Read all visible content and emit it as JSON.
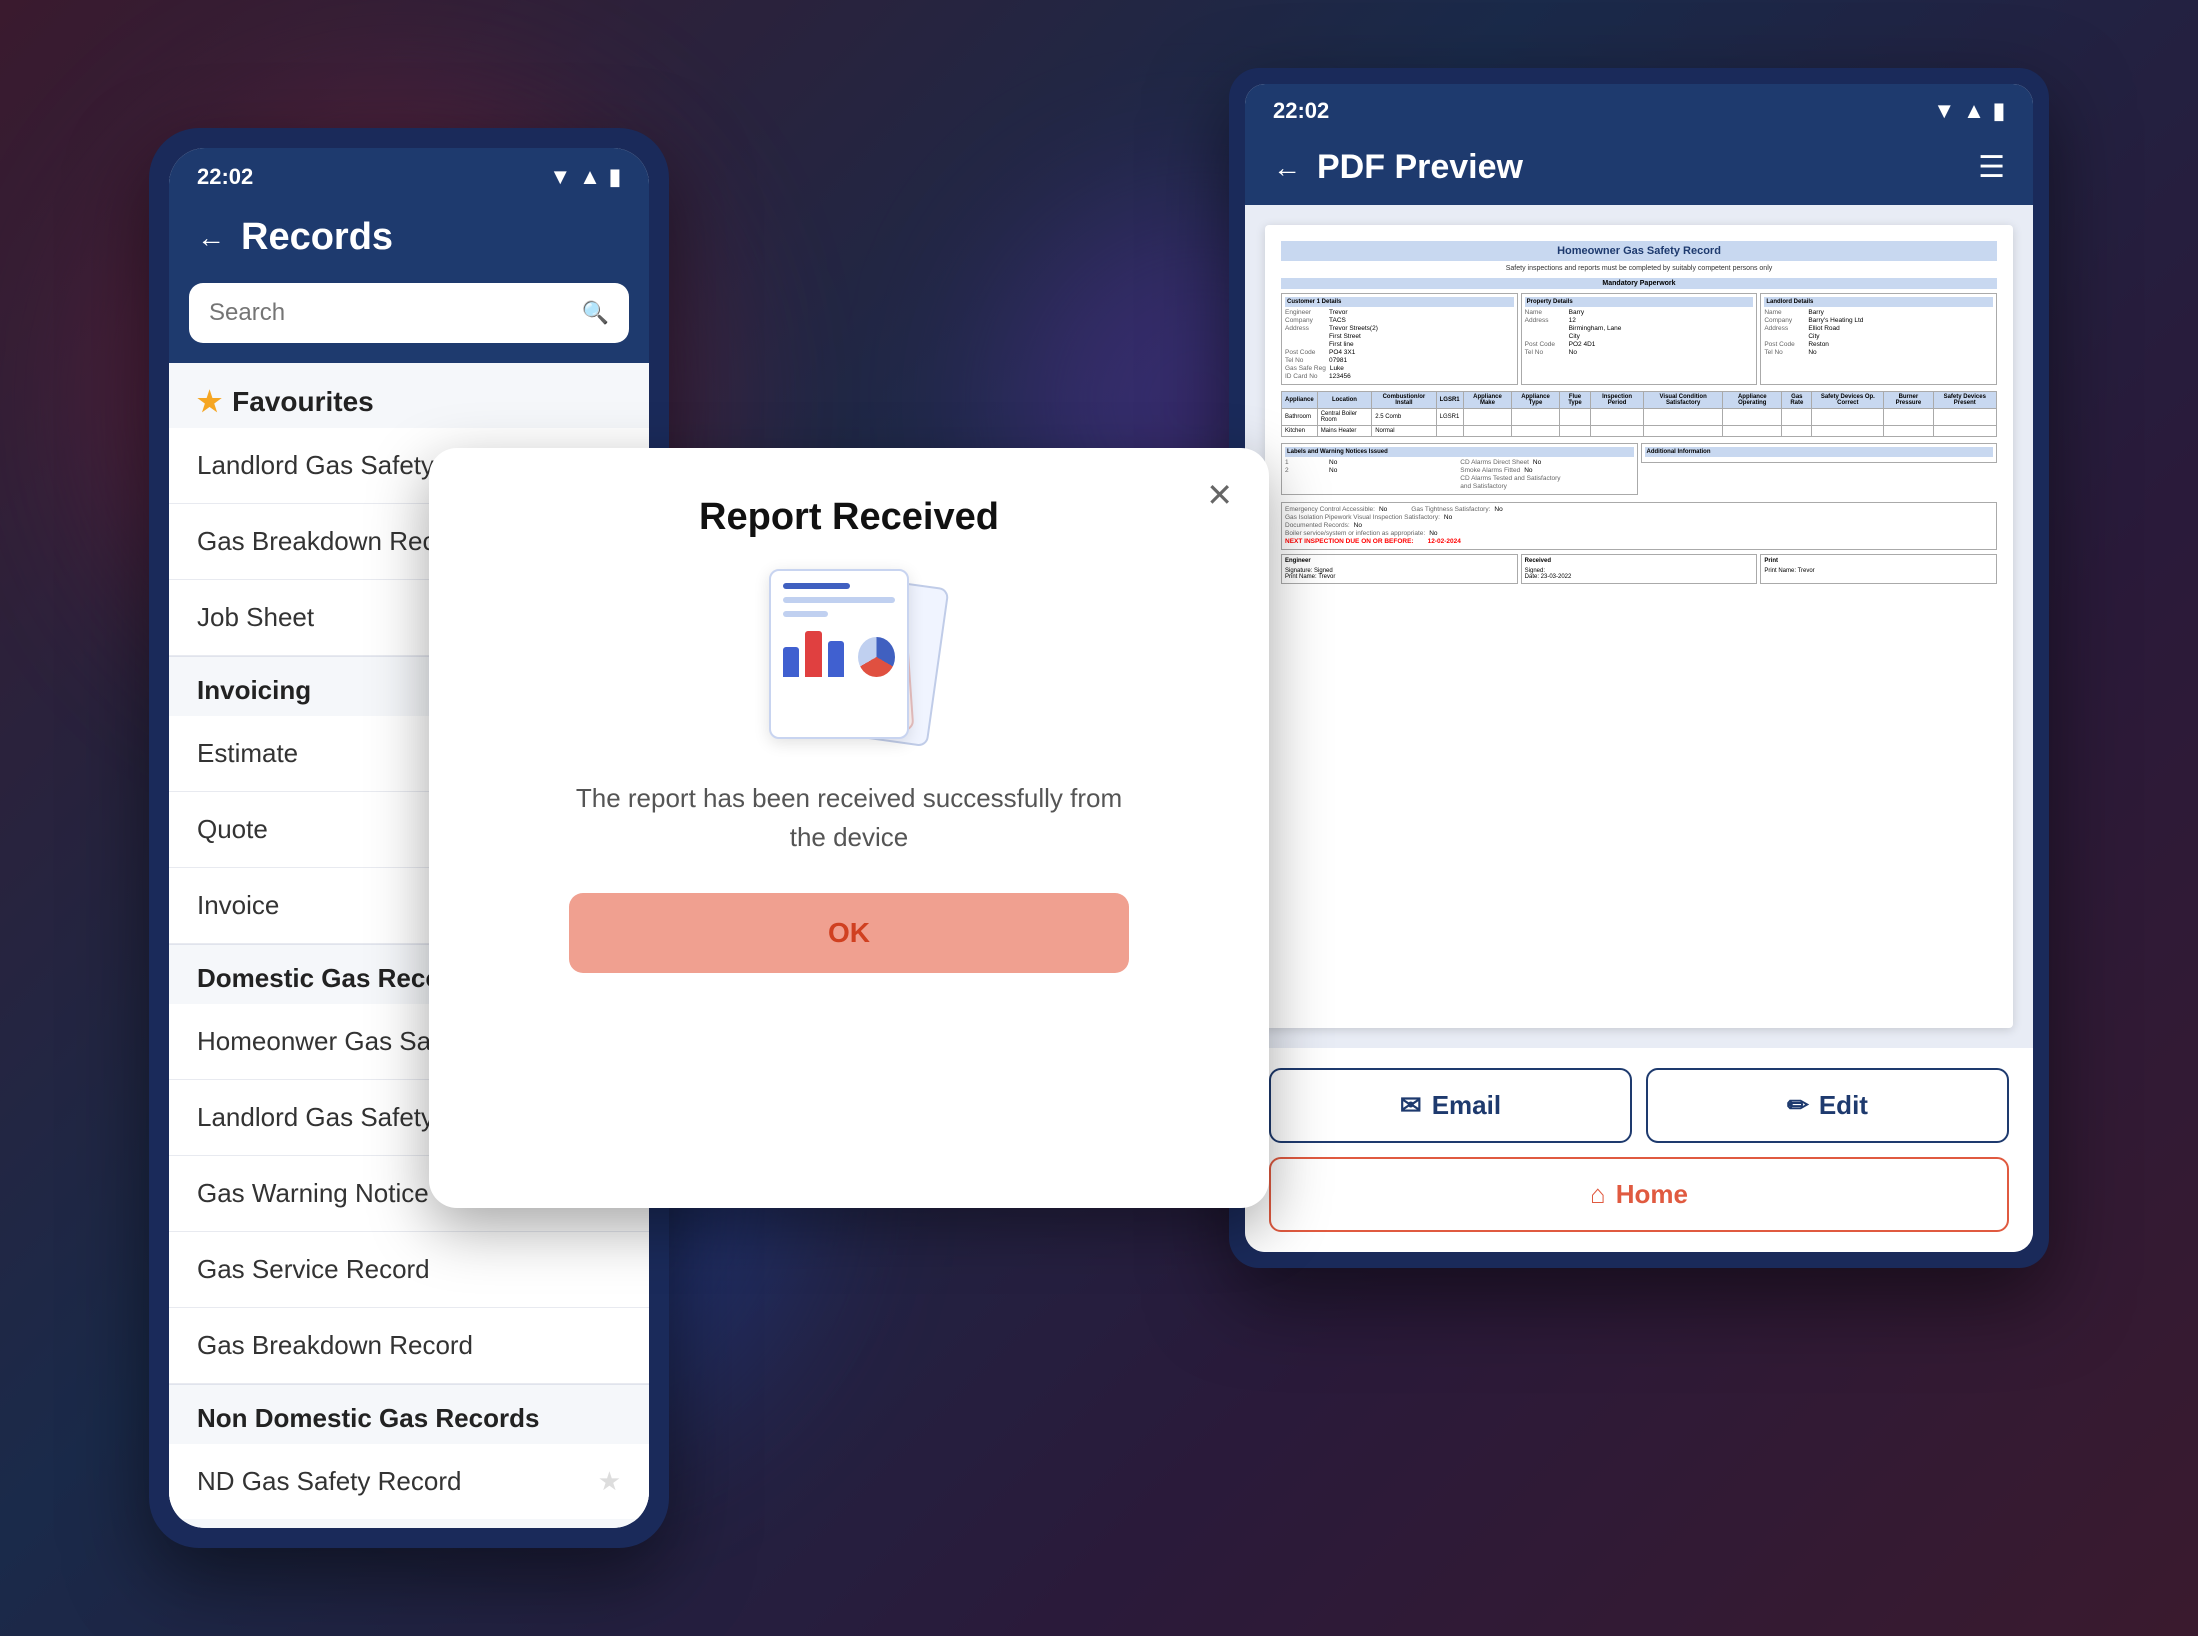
{
  "phone": {
    "status_time": "22:02",
    "header": {
      "back_label": "←",
      "title": "Records"
    },
    "search": {
      "placeholder": "Search"
    },
    "sections": [
      {
        "id": "favourites",
        "label": "Favourites",
        "has_star": true,
        "items": [
          {
            "label": "Landlord Gas Safety Record",
            "starred": true
          },
          {
            "label": "Gas Breakdown Record",
            "starred": true
          },
          {
            "label": "Job Sheet",
            "starred": true
          }
        ]
      },
      {
        "id": "invoicing",
        "label": "Invoicing",
        "has_star": false,
        "items": [
          {
            "label": "Estimate",
            "starred": false
          },
          {
            "label": "Quote",
            "starred": false
          },
          {
            "label": "Invoice",
            "starred": false
          }
        ]
      },
      {
        "id": "domestic-gas",
        "label": "Domestic Gas Records",
        "has_star": false,
        "items": [
          {
            "label": "Homeonwer Gas Safety Record",
            "starred": false
          },
          {
            "label": "Landlord Gas Safety Record",
            "starred": false
          },
          {
            "label": "Gas Warning Notice",
            "starred": false
          },
          {
            "label": "Gas Service Record",
            "starred": false
          },
          {
            "label": "Gas Breakdown Record",
            "starred": false
          }
        ]
      },
      {
        "id": "non-domestic-gas",
        "label": "Non Domestic Gas Records",
        "has_star": false,
        "items": [
          {
            "label": "ND Gas Safety Record",
            "starred": false
          }
        ]
      }
    ]
  },
  "tablet": {
    "status_time": "22:02",
    "header": {
      "back_label": "←",
      "title": "PDF Preview",
      "menu_icon": "☰"
    },
    "pdf": {
      "doc_title": "Homeowner Gas Safety Record",
      "doc_subtitle": "Safety inspections and reports must be completed by suitably competent persons only",
      "sections_label": "Mandatory Paperwork"
    },
    "actions": {
      "email_label": "Email",
      "edit_label": "Edit",
      "home_label": "Home"
    }
  },
  "modal": {
    "title": "Report Received",
    "message": "The report has been received successfully from the device",
    "ok_label": "OK",
    "close_icon": "✕"
  }
}
